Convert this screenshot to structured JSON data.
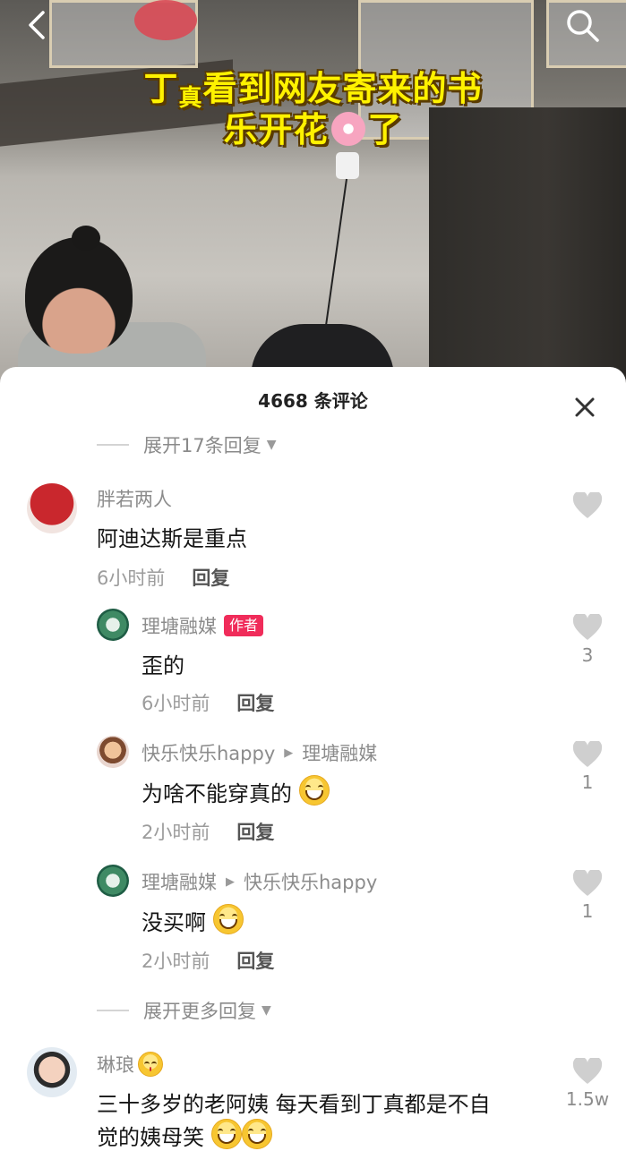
{
  "video": {
    "caption_line1_a": "丁",
    "caption_line1_small": "真",
    "caption_line1_b": "看到网友寄来的书",
    "caption_line2_a": "乐开花",
    "caption_line2_b": "了"
  },
  "comments_panel": {
    "title": "4668 条评论",
    "expand_top": "展开17条回复",
    "expand_more": "展开更多回复",
    "reply_label": "回复",
    "author_badge": "作者"
  },
  "comments": [
    {
      "user": "胖若两人",
      "text": "阿迪达斯是重点",
      "time": "6小时前",
      "likes": ""
    },
    {
      "user": "理塘融媒",
      "text": "歪的",
      "time": "6小时前",
      "likes": "3"
    },
    {
      "user": "快乐快乐happy",
      "reply_to": "理塘融媒",
      "text": "为啥不能穿真的",
      "time": "2小时前",
      "likes": "1"
    },
    {
      "user": "理塘融媒",
      "reply_to": "快乐快乐happy",
      "text": "没买啊",
      "time": "2小时前",
      "likes": "1"
    },
    {
      "user": "琳琅",
      "text_line1": "三十多岁的老阿姨 每天看到丁真都是不自",
      "text_line2": "觉的姨母笑",
      "likes": "1.5w"
    }
  ],
  "icons": [
    "back-arrow-icon",
    "search-icon",
    "close-icon",
    "heart-icon",
    "emoji-icon",
    "triangle-down-icon"
  ]
}
